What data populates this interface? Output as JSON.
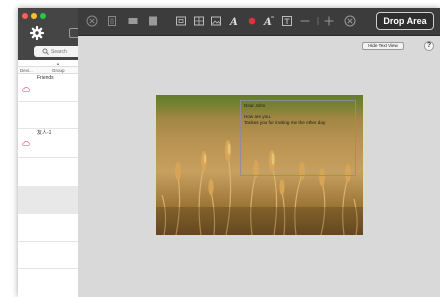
{
  "window": {
    "colors": {
      "close": "#fe5f57",
      "minimize": "#febc2e",
      "zoom": "#28c840"
    }
  },
  "sidebar": {
    "settings_icon": "gear-icon",
    "search": {
      "placeholder": "Search"
    },
    "columns": [
      "Devi...",
      "Group"
    ],
    "groups": [
      {
        "label": "Friends",
        "icon": "cloud-icon"
      },
      {
        "label": "友人-1",
        "icon": "cloud-icon"
      }
    ]
  },
  "toolbar": {
    "tools": [
      "delete-icon",
      "document-icon",
      "card-icon",
      "page-icon",
      "window-icon",
      "table-icon",
      "image-icon",
      "text-style-icon",
      "record-icon",
      "text-format-icon",
      "text-frame-icon",
      "minus-icon",
      "plus-icon",
      "clear-icon"
    ],
    "drop_area_label": "Drop Area",
    "record_color": "#e0323a"
  },
  "canvas": {
    "hide_text_view_label": "Hide Text View",
    "help_label": "?",
    "photo": "wheat-field-image",
    "text_box": "Dear John\n\nHow are you.\nTankes you for inviting me the other day."
  }
}
